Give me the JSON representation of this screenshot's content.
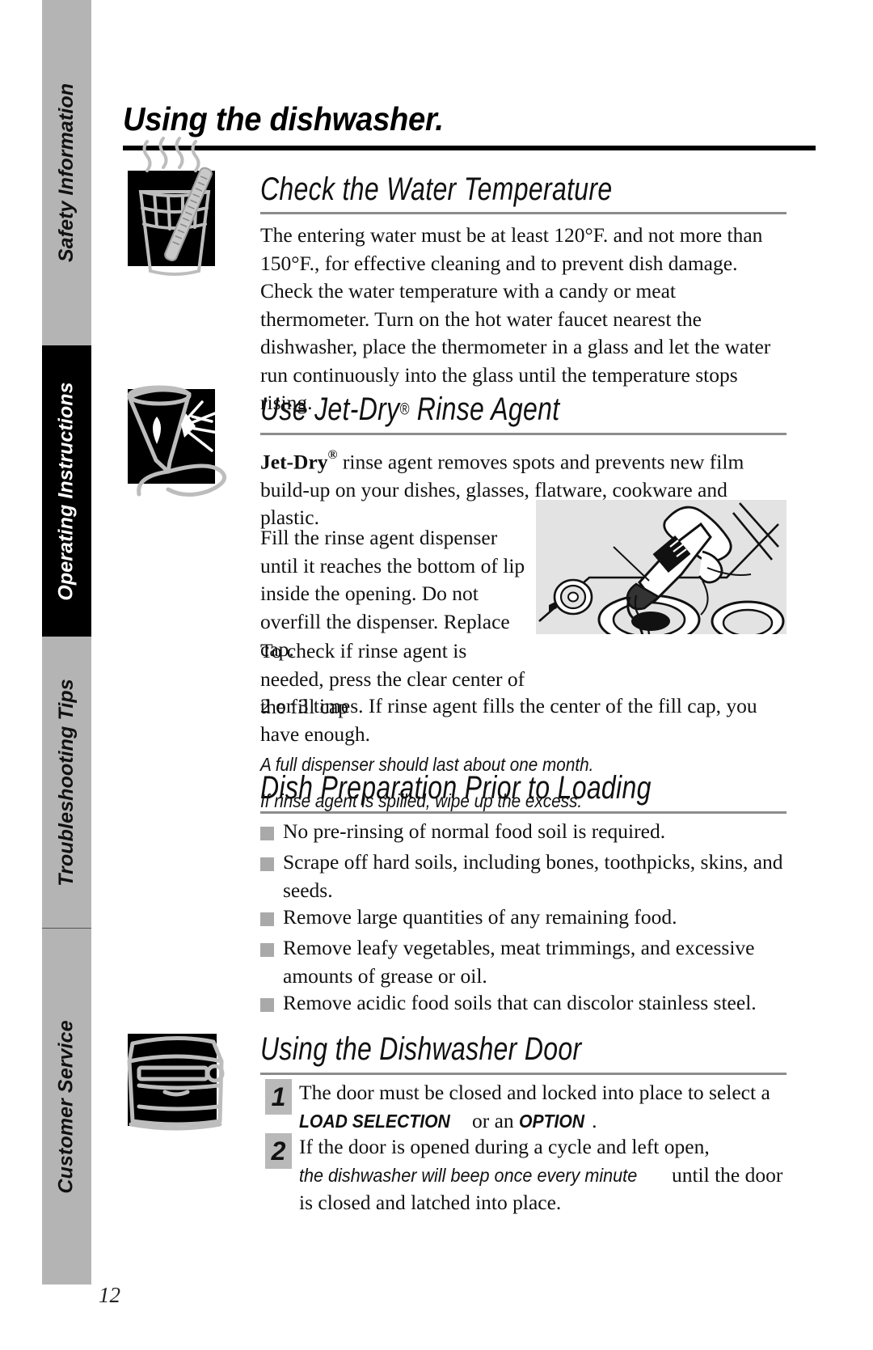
{
  "sidebar": {
    "tabs": [
      {
        "label": "Safety Information",
        "state": "inactive"
      },
      {
        "label": "Operating Instructions",
        "state": "active"
      },
      {
        "label": "Troubleshooting Tips",
        "state": "inactive"
      },
      {
        "label": "Customer Service",
        "state": "inactive"
      }
    ]
  },
  "page": {
    "title": "Using the dishwasher.",
    "number": "12"
  },
  "sections": {
    "water_temp": {
      "heading": "Check the Water Temperature",
      "body": "The entering water must be at least 120°F. and not more than 150°F., for effective cleaning and to prevent dish damage. Check the water temperature with a candy or meat thermometer. Turn on the hot water faucet nearest the dishwasher, place the thermometer in a glass and let the water run continuously into the glass until the temperature stops rising.",
      "icon": "glass-thermometer-icon"
    },
    "jet_dry": {
      "heading_pre": "Use Jet-Dry",
      "heading_reg": "®",
      "heading_post": " Rinse Agent",
      "intro_bold": "Jet-Dry",
      "intro_reg": "®",
      "intro_rest": " rinse agent removes spots and prevents new film build-up on your dishes, glasses, flatware, cookware and plastic.",
      "para_fill": "Fill the rinse agent dispenser until it reaches the bottom of lip inside the opening. Do not overfill the dispenser. Replace cap.",
      "para_check_top": "To check if rinse agent is needed, press the clear center of the fill cap",
      "para_check_rest": "2 or 3 times. If rinse agent fills the center of the fill cap, you have enough.",
      "note1": "A full dispenser should last about one month.",
      "note2": "If rinse agent is spilled, wipe up the excess.",
      "icon": "sparkling-glass-icon",
      "photo_caption": "rinse-agent-dispenser-photo"
    },
    "dish_prep": {
      "heading": "Dish Preparation Prior to Loading",
      "bullets": [
        "No pre-rinsing of normal food soil is required.",
        "Scrape off hard soils, including bones, toothpicks, skins, and seeds.",
        "Remove large quantities of any remaining food.",
        "Remove leafy vegetables, meat trimmings, and excessive amounts of grease or oil.",
        "Remove acidic food soils that can discolor stainless steel."
      ]
    },
    "door": {
      "heading": "Using the Dishwasher Door",
      "icon": "dishwasher-front-icon",
      "steps": [
        {
          "number": "1",
          "part1": "The door must be closed and locked into place to select a ",
          "emph1": "LOAD SELECTION",
          "part2": " or an ",
          "emph2": "OPTION",
          "part3": "."
        },
        {
          "number": "2",
          "part1": "If the door is opened during a cycle and left open, ",
          "emph1": "the dishwasher will beep once every minute",
          "part2": " until the door is closed and latched into place."
        }
      ]
    }
  },
  "colors": {
    "sidebar_inactive": "#b4b4b4",
    "sidebar_active": "#000000",
    "bullet": "#a9a9a9",
    "rule": "#8c8c8c",
    "step_box": "#b9b9b9",
    "photo_bg": "#e3e3e3"
  }
}
